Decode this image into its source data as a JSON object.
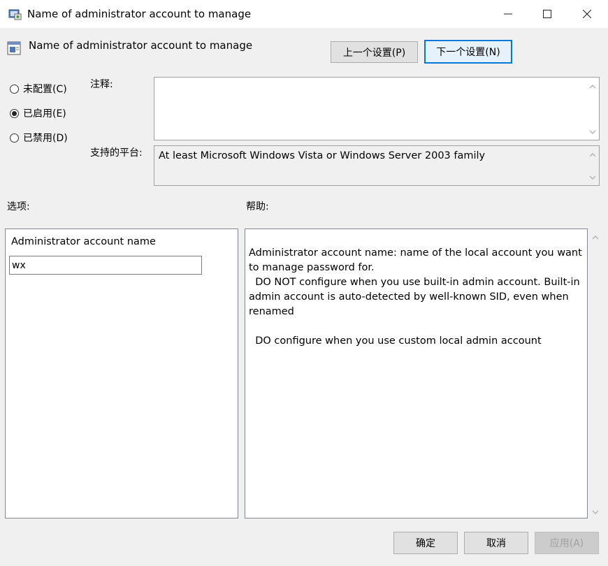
{
  "window": {
    "title": "Name of administrator account to manage"
  },
  "header": {
    "title": "Name of administrator account to manage",
    "prev_button": "上一个设置(P)",
    "next_button": "下一个设置(N)"
  },
  "state_options": [
    {
      "label": "未配置(C)",
      "checked": false
    },
    {
      "label": "已启用(E)",
      "checked": true
    },
    {
      "label": "已禁用(D)",
      "checked": false
    }
  ],
  "comment": {
    "label": "注释:",
    "value": ""
  },
  "platform": {
    "label": "支持的平台:",
    "value": "At least Microsoft Windows Vista or Windows Server 2003 family"
  },
  "options": {
    "label": "选项:",
    "field_label": "Administrator account name",
    "field_value": "wx"
  },
  "help": {
    "label": "帮助:",
    "text": "Administrator account name: name of the local account you want to manage password for.\n  DO NOT configure when you use built-in admin account. Built-in admin account is auto-detected by well-known SID, even when renamed\n\n  DO configure when you use custom local admin account"
  },
  "footer": {
    "ok": "确定",
    "cancel": "取消",
    "apply": "应用(A)"
  },
  "icons": {
    "window": "policy-settings-icon",
    "header": "policy-document-icon"
  },
  "colors": {
    "accent": "#0078d7",
    "dialog_bg": "#f0f0f0"
  }
}
